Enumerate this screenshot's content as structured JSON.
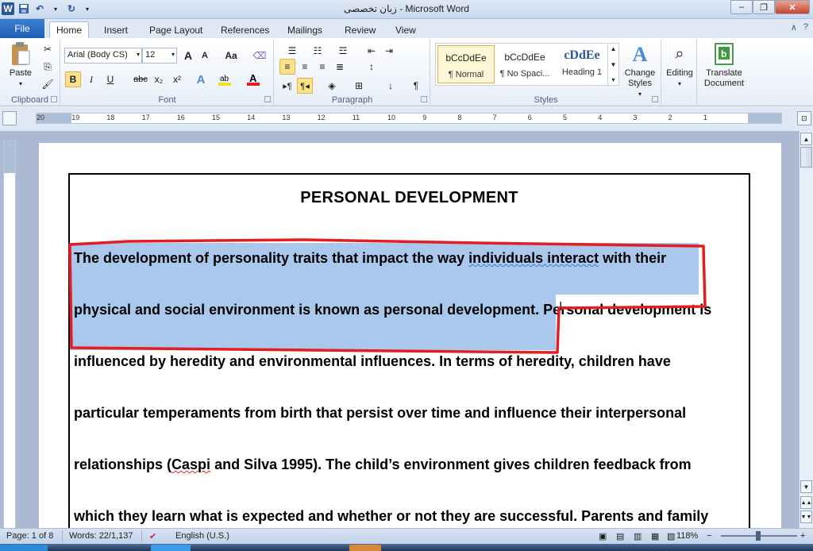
{
  "window": {
    "title": "زبان تخصصی - Microsoft Word",
    "minimize": "–",
    "restore": "❐",
    "close": "✕"
  },
  "quick_access": {
    "app_icon": "W",
    "save_icon": "floppy-icon",
    "undo_icon": "undo-icon",
    "redo_icon": "redo-icon"
  },
  "tabs": {
    "file": "File",
    "items": [
      "Home",
      "Insert",
      "Page Layout",
      "References",
      "Mailings",
      "Review",
      "View"
    ],
    "active": "Home"
  },
  "ribbon": {
    "clipboard": {
      "paste": "Paste",
      "label": "Clipboard"
    },
    "font": {
      "family": "Arial (Body CS)",
      "size": "12",
      "label": "Font",
      "bold": "B",
      "italic": "I",
      "underline": "U",
      "strike": "abc",
      "subscript": "x₂",
      "superscript": "x²",
      "grow": "A",
      "shrink": "A",
      "case": "Aa",
      "font_color_accent": "#e41d23",
      "highlight_accent": "#f5e11a"
    },
    "paragraph": {
      "label": "Paragraph",
      "pilcrow": "¶"
    },
    "styles": {
      "label": "Styles",
      "items": [
        {
          "preview": "bCcDdEe",
          "name": "¶ Normal"
        },
        {
          "preview": "bCcDdEe",
          "name": "¶ No Spaci..."
        },
        {
          "preview": "cDdEe",
          "name": "Heading 1"
        }
      ],
      "change_styles": "Change Styles"
    },
    "editing": {
      "label": "Editing"
    },
    "translate": {
      "label": "Translate Document"
    }
  },
  "ruler": {
    "numbers": [
      "20",
      "19",
      "18",
      "17",
      "16",
      "15",
      "14",
      "13",
      "12",
      "11",
      "10",
      "9",
      "8",
      "7",
      "6",
      "5",
      "4",
      "3",
      "2",
      "1"
    ]
  },
  "document": {
    "title": "PERSONAL DEVELOPMENT",
    "lines": [
      {
        "a": "The development of personality traits that impact the way ",
        "b": "individuals  interact",
        "c": " with their"
      },
      {
        "a": "physical and social environment is known as personal development.",
        "b": " Personal development is"
      },
      {
        "a": "influenced by heredity and environmental influences. In terms of heredity, children have"
      },
      {
        "a": "particular temperaments from birth that persist over time and influence their interpersonal"
      },
      {
        "a": "relationships (",
        "b": "Caspi",
        "c": " and Silva 1995). The child’s environment gives children feedback from"
      },
      {
        "a": "which they learn what is expected and whether or not they are successful. Parents and family"
      }
    ],
    "selection_color": "#a9c8ec",
    "annotation_color": "#e41d23"
  },
  "status": {
    "page": "Page: 1 of 8",
    "words": "Words: 22/1,137",
    "language": "English (U.S.)",
    "zoom": "118%",
    "zoom_minus": "−",
    "zoom_plus": "+"
  }
}
